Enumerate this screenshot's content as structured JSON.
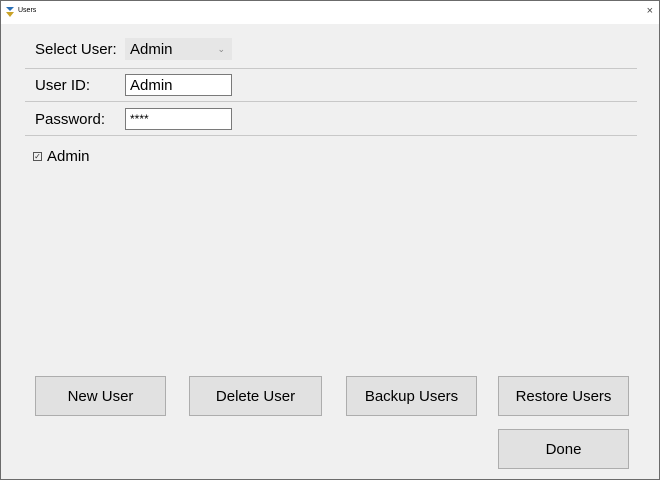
{
  "window": {
    "title": "Users",
    "close_glyph": "×",
    "app_icon": "users-app-icon"
  },
  "form": {
    "select_user_label": "Select User:",
    "select_user_value": "Admin",
    "user_id_label": "User ID:",
    "user_id_value": "Admin",
    "password_label": "Password:",
    "password_value": "****",
    "admin_checkbox_label": "Admin",
    "admin_checked": true
  },
  "buttons": {
    "new_user": "New User",
    "delete_user": "Delete User",
    "backup_users": "Backup Users",
    "restore_users": "Restore Users",
    "done": "Done"
  },
  "colors": {
    "window_bg": "#f0f0f0",
    "button_bg": "#e1e1e1",
    "select_bg": "#e6e6e6"
  }
}
